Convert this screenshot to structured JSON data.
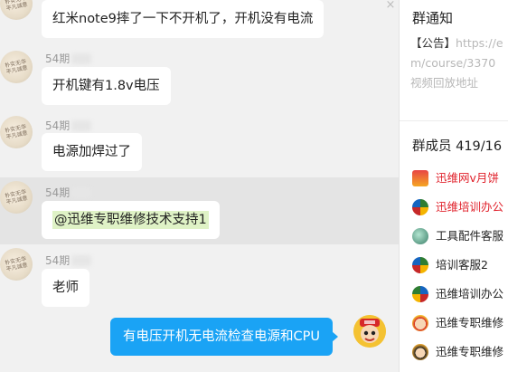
{
  "chat": {
    "messages": [
      {
        "sender": "",
        "text": "红米note9摔了一下不开机了，开机没有电流"
      },
      {
        "sender": "54期",
        "text": "开机键有1.8v电压"
      },
      {
        "sender": "54期",
        "text": "电源加焊过了"
      },
      {
        "sender": "54期",
        "text": "@迅维专职维修技术支持1"
      },
      {
        "sender": "54期",
        "text": "老师"
      }
    ],
    "self_message": "有电压开机无电流检查电源和CPU",
    "close_glyph": "×"
  },
  "sidebar": {
    "notice_title": "群通知",
    "notice_tag": "【公告】",
    "notice_url_1": "https://e",
    "notice_url_2": "m/course/3370",
    "notice_sub": "视频回放地址",
    "members_title": "群成员 419/16",
    "members": [
      {
        "name": "迅维网v月饼",
        "color": "#e0202a"
      },
      {
        "name": "迅维培训办公",
        "color": "#e0202a"
      },
      {
        "name": "工具配件客服",
        "color": "#222222"
      },
      {
        "name": "培训客服2",
        "color": "#222222"
      },
      {
        "name": "迅维培训办公",
        "color": "#222222"
      },
      {
        "name": "迅维专职维修",
        "color": "#222222"
      },
      {
        "name": "迅维专职维修",
        "color": "#222222"
      }
    ]
  }
}
